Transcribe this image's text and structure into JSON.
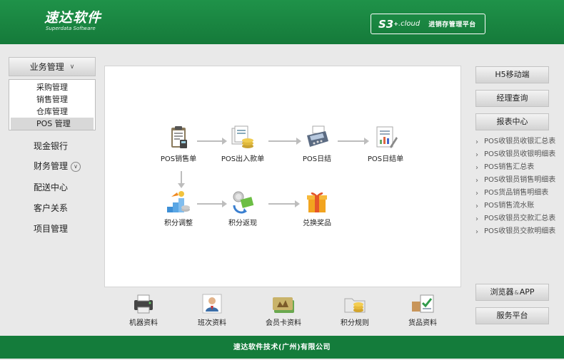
{
  "header": {
    "logo_main": "速达软件",
    "logo_sub": "Superdata Software",
    "brand_s3": "S3",
    "brand_plus": "+",
    "brand_cloud": ".cloud",
    "brand_text": "进销存管理平台"
  },
  "left_menu": {
    "business": "业务管理",
    "sub_items": [
      "采购管理",
      "销售管理",
      "仓库管理",
      "POS 管理"
    ],
    "cash_bank": "现金银行",
    "finance": "财务管理",
    "delivery": "配送中心",
    "customer": "客户关系",
    "project": "项目管理"
  },
  "flow": {
    "pos_sales": "POS销售单",
    "pos_inout": "POS出入款单",
    "pos_daily": "POS日结",
    "pos_daily_bill": "POS日结单",
    "points_adjust": "积分调整",
    "points_return": "积分返现",
    "redeem": "兑换奖品"
  },
  "bottom": {
    "machine": "机器资料",
    "shift": "班次资料",
    "member_card": "会员卡资料",
    "points_rule": "积分规则",
    "goods": "货品资料"
  },
  "right": {
    "h5": "H5移动端",
    "manager": "经理查询",
    "report": "报表中心",
    "reports": [
      "POS收银员收银汇总表",
      "POS收银员收银明细表",
      "POS销售汇总表",
      "POS收银员销售明细表",
      "POS货品销售明细表",
      "POS销售流水账",
      "POS收银员交款汇总表",
      "POS收银员交款明细表"
    ],
    "browser": "浏览器",
    "browser_amp": "&",
    "browser_app": "APP",
    "service": "服务平台"
  },
  "footer": "速达软件技术(广州)有限公司"
}
